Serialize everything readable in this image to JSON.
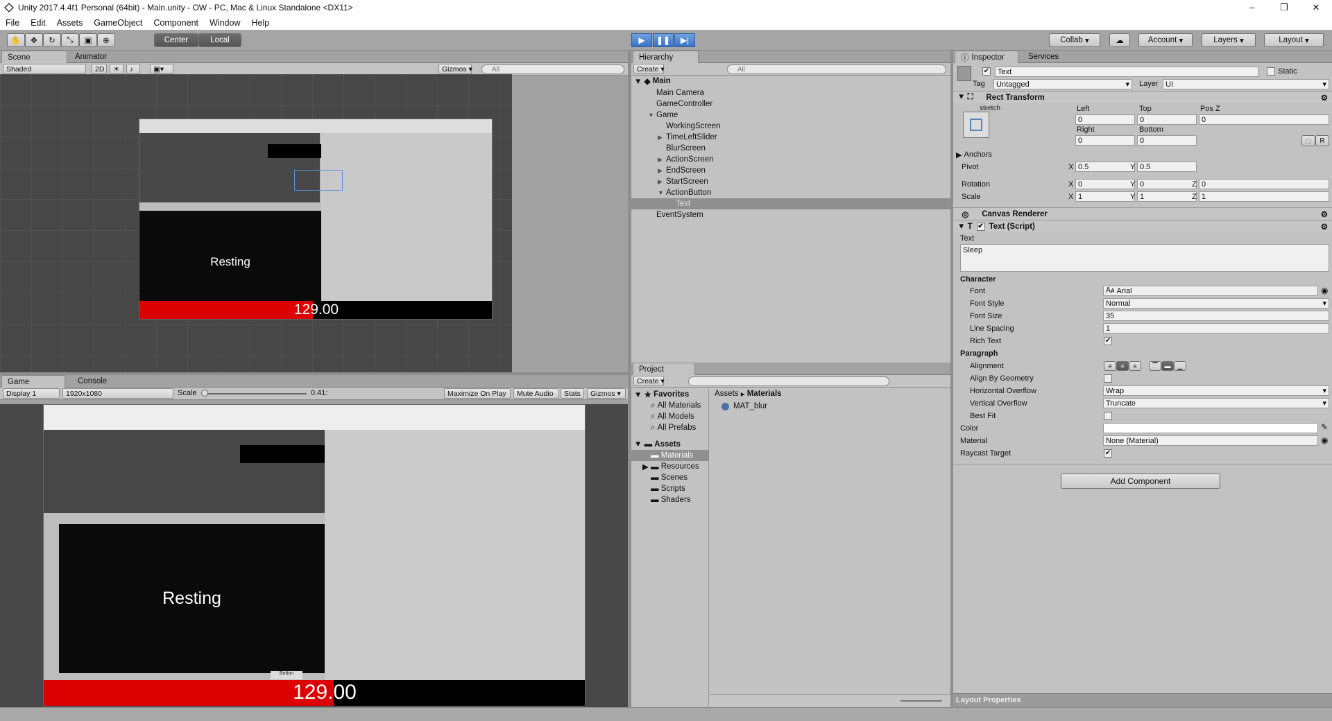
{
  "window": {
    "title": "Unity 2017.4.4f1 Personal (64bit) - Main.unity - OW - PC, Mac & Linux Standalone <DX11>",
    "minimize": "–",
    "maximize": "❐",
    "close": "✕"
  },
  "menu": [
    "File",
    "Edit",
    "Assets",
    "GameObject",
    "Component",
    "Window",
    "Help"
  ],
  "toolbar": {
    "center": "Center",
    "local": "Local",
    "collab": "Collab",
    "account": "Account",
    "layers": "Layers",
    "layout": "Layout",
    "tools": [
      "hand-icon",
      "move-icon",
      "rotate-icon",
      "scale-icon",
      "rect-icon",
      "transform-icon"
    ]
  },
  "scene": {
    "tab": "Scene",
    "tab2": "Animator",
    "shading": "Shaded",
    "mode2d": "2D",
    "gizmos": "Gizmos",
    "search": "All"
  },
  "game": {
    "tab": "Game",
    "tab2": "Console",
    "display": "Display 1",
    "resolution": "1920x1080",
    "scale_label": "Scale",
    "scale_value": "0.41:",
    "maximize": "Maximize On Play",
    "mute": "Mute Audio",
    "stats": "Stats",
    "gizmos": "Gizmos",
    "resting": "Resting",
    "number": "129.00",
    "button": "Button"
  },
  "scene_preview": {
    "resting": "Resting",
    "number": "129.00"
  },
  "hierarchy": {
    "tab": "Hierarchy",
    "create": "Create",
    "search": "All",
    "scene": "Main",
    "items": [
      {
        "label": "Main Camera",
        "indent": 1
      },
      {
        "label": "GameController",
        "indent": 1
      },
      {
        "label": "Game",
        "indent": 1,
        "arrow": "▼"
      },
      {
        "label": "WorkingScreen",
        "indent": 2
      },
      {
        "label": "TimeLeftSlider",
        "indent": 2,
        "arrow": "▶"
      },
      {
        "label": "BlurScreen",
        "indent": 2
      },
      {
        "label": "ActionScreen",
        "indent": 2,
        "arrow": "▶"
      },
      {
        "label": "EndScreen",
        "indent": 2,
        "arrow": "▶"
      },
      {
        "label": "StartScreen",
        "indent": 2,
        "arrow": "▶"
      },
      {
        "label": "ActionButton",
        "indent": 2,
        "arrow": "▼"
      },
      {
        "label": "Text",
        "indent": 3,
        "selected": true
      },
      {
        "label": "EventSystem",
        "indent": 1
      }
    ]
  },
  "project": {
    "tab": "Project",
    "create": "Create",
    "favorites": "Favorites",
    "fav_items": [
      "All Materials",
      "All Models",
      "All Prefabs"
    ],
    "assets": "Assets",
    "asset_items": [
      "Materials",
      "Resources",
      "Scenes",
      "Scripts",
      "Shaders"
    ],
    "breadcrumb1": "Assets",
    "breadcrumb2": "Materials",
    "file": "MAT_blur"
  },
  "inspector": {
    "tab": "Inspector",
    "tab2": "Services",
    "name": "Text",
    "static": "Static",
    "tag_label": "Tag",
    "tag": "Untagged",
    "layer_label": "Layer",
    "layer": "UI",
    "rect_transform": "Rect Transform",
    "stretch": "stretch",
    "left_label": "Left",
    "top_label": "Top",
    "posz_label": "Pos Z",
    "left": "0",
    "top": "0",
    "posz": "0",
    "right_label": "Right",
    "bottom_label": "Bottom",
    "right": "0",
    "bottom": "0",
    "r": "R",
    "anchors": "Anchors",
    "pivot": "Pivot",
    "pivot_x": "0.5",
    "pivot_y": "0.5",
    "rotation": "Rotation",
    "rot_x": "0",
    "rot_y": "0",
    "rot_z": "0",
    "scale": "Scale",
    "scale_x": "1",
    "scale_y": "1",
    "scale_z": "1",
    "canvas_renderer": "Canvas Renderer",
    "text_script": "Text (Script)",
    "text_label": "Text",
    "text_value": "Sleep",
    "character": "Character",
    "font_label": "Font",
    "font": "Arial",
    "fontstyle_label": "Font Style",
    "fontstyle": "Normal",
    "fontsize_label": "Font Size",
    "fontsize": "35",
    "linespacing_label": "Line Spacing",
    "linespacing": "1",
    "richtext_label": "Rich Text",
    "paragraph": "Paragraph",
    "alignment_label": "Alignment",
    "abg_label": "Align By Geometry",
    "hoverflow_label": "Horizontal Overflow",
    "hoverflow": "Wrap",
    "voverflow_label": "Vertical Overflow",
    "voverflow": "Truncate",
    "bestfit_label": "Best Fit",
    "color_label": "Color",
    "material_label": "Material",
    "material": "None (Material)",
    "raycast_label": "Raycast Target",
    "add_component": "Add Component",
    "layout_props": "Layout Properties",
    "x": "X",
    "y": "Y",
    "z": "Z"
  }
}
